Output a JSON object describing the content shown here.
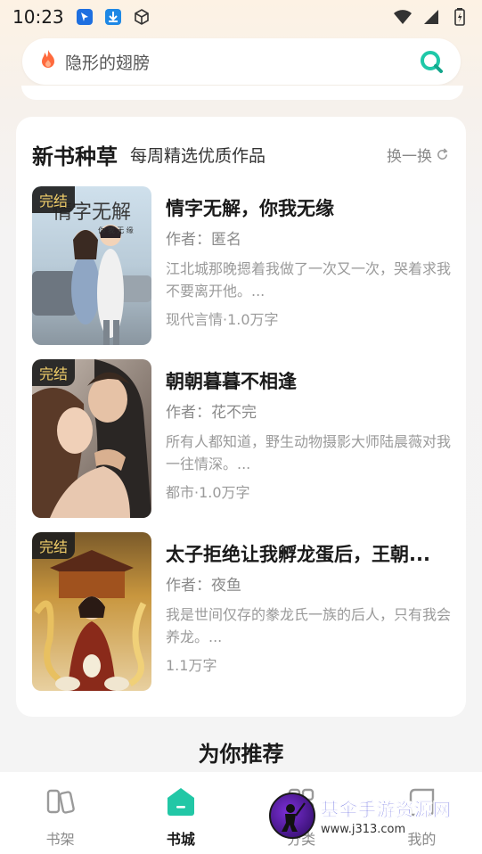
{
  "status_bar": {
    "time": "10:23",
    "left_icons": [
      "pin-icon",
      "download-icon",
      "cube-icon"
    ],
    "right_icons": [
      "wifi-icon",
      "signal-icon",
      "battery-icon"
    ]
  },
  "search": {
    "placeholder": "隐形的翅膀",
    "left_icon": "flame-icon",
    "right_icon": "search-icon",
    "accent_color": "#1fc8a8"
  },
  "section": {
    "title": "新书种草",
    "subtitle": "每周精选优质作品",
    "refresh_label": "换一换",
    "refresh_icon": "refresh-icon"
  },
  "books": [
    {
      "badge": "完结",
      "title": "情字无解，你我无缘",
      "author": "作者：匿名",
      "desc": "江北城那晚摁着我做了一次又一次，哭着求我不要离开他。...",
      "meta": "现代言情·1.0万字",
      "cover_text": "情字无解",
      "cover_subtext": "你 我 无 缘"
    },
    {
      "badge": "完结",
      "title": "朝朝暮暮不相逢",
      "author": "作者：花不完",
      "desc": "所有人都知道，野生动物摄影大师陆晨薇对我一往情深。...",
      "meta": "都市·1.0万字"
    },
    {
      "badge": "完结",
      "title": "太子拒绝让我孵龙蛋后，王朝...",
      "author": "作者：夜鱼",
      "desc": "我是世间仅存的豢龙氏一族的后人，只有我会养龙。...",
      "meta": "1.1万字"
    }
  ],
  "recommend_heading": "为你推荐",
  "tabs": [
    {
      "label": "书架",
      "icon": "bookshelf-icon",
      "active": false
    },
    {
      "label": "书城",
      "icon": "bookstore-icon",
      "active": true
    },
    {
      "label": "分类",
      "icon": "category-icon",
      "active": false
    },
    {
      "label": "我的",
      "icon": "profile-icon",
      "active": false
    }
  ],
  "watermark": {
    "title": "基伞手游资源网",
    "url": "www.j313.com"
  }
}
